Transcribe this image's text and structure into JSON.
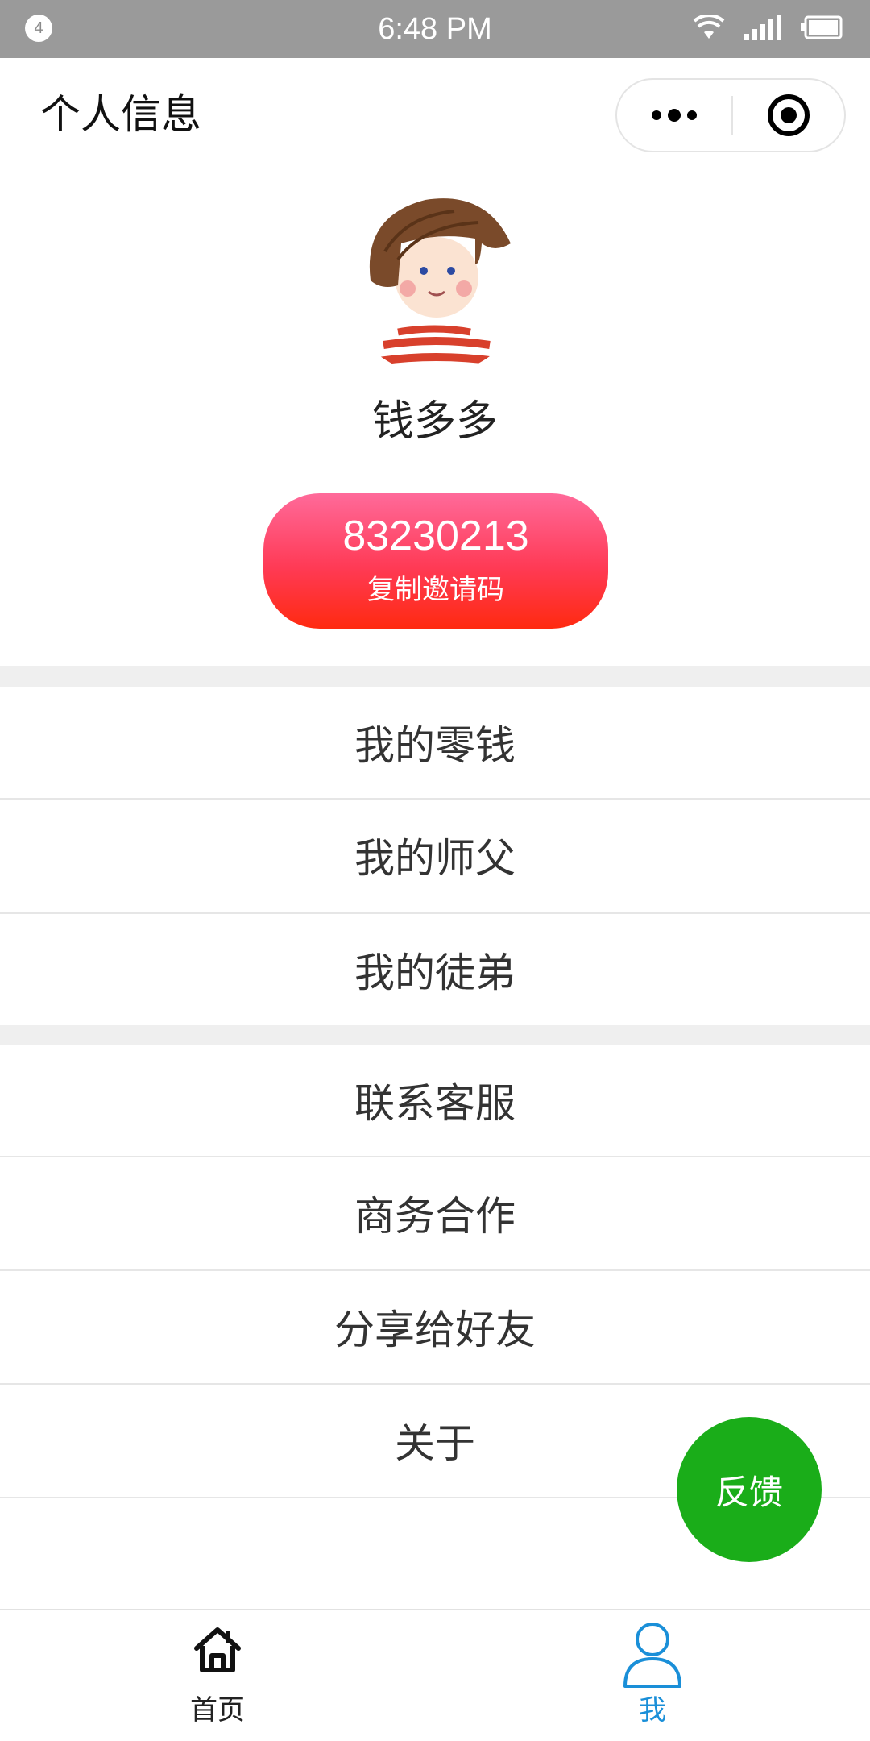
{
  "status_bar": {
    "notification_count": "4",
    "time": "6:48 PM",
    "icons": [
      "wifi-icon",
      "signal-icon",
      "battery-icon"
    ]
  },
  "header": {
    "title": "个人信息",
    "capsule_icons": [
      "more-dots-icon",
      "close-target-icon"
    ]
  },
  "profile": {
    "username": "钱多多",
    "invite_code": "83230213",
    "invite_label": "复制邀请码"
  },
  "menu": {
    "group1": [
      "我的零钱",
      "我的师父",
      "我的徒弟"
    ],
    "group2": [
      "联系客服",
      "商务合作",
      "分享给好友",
      "关于"
    ]
  },
  "feedback": {
    "label": "反馈"
  },
  "tabbar": {
    "tabs": [
      {
        "label": "首页",
        "icon": "home-icon",
        "active": false
      },
      {
        "label": "我",
        "icon": "person-icon",
        "active": true
      }
    ]
  },
  "colors": {
    "status_bar": "#9a9a9a",
    "invite_gradient_top": "#ff6a9a",
    "invite_gradient_bottom": "#ff2a10",
    "feedback_green": "#1aad19",
    "tab_active": "#1a8fd8",
    "tab_inactive": "#222222",
    "separator_band": "#efefef"
  }
}
